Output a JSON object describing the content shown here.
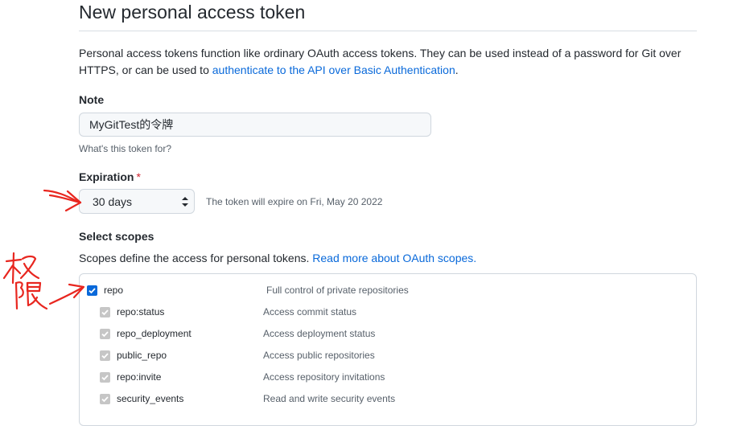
{
  "page": {
    "title": "New personal access token",
    "description_prefix": "Personal access tokens function like ordinary OAuth access tokens. They can be used instead of a password for Git over HTTPS, or can be used to ",
    "description_link": "authenticate to the API over Basic Authentication",
    "description_suffix": "."
  },
  "note": {
    "label": "Note",
    "value": "MyGitTest的令牌",
    "hint": "What's this token for?"
  },
  "expiration": {
    "label": "Expiration",
    "required_mark": "*",
    "selected": "30 days",
    "hint": "The token will expire on Fri, May 20 2022"
  },
  "scopes": {
    "label": "Select scopes",
    "description_prefix": "Scopes define the access for personal tokens. ",
    "description_link": "Read more about OAuth scopes.",
    "items": [
      {
        "name": "repo",
        "description": "Full control of private repositories",
        "checked": true,
        "disabled": false
      },
      {
        "name": "repo:status",
        "description": "Access commit status",
        "checked": true,
        "disabled": true
      },
      {
        "name": "repo_deployment",
        "description": "Access deployment status",
        "checked": true,
        "disabled": true
      },
      {
        "name": "public_repo",
        "description": "Access public repositories",
        "checked": true,
        "disabled": true
      },
      {
        "name": "repo:invite",
        "description": "Access repository invitations",
        "checked": true,
        "disabled": true
      },
      {
        "name": "security_events",
        "description": "Read and write security events",
        "checked": true,
        "disabled": true
      }
    ]
  },
  "annotations": {
    "handwritten_text": "权限",
    "color": "#e8261f"
  },
  "colors": {
    "link": "#0969da",
    "checkbox_checked": "#0969da",
    "checkbox_disabled": "#c6c6c6",
    "required": "#cf222e"
  }
}
